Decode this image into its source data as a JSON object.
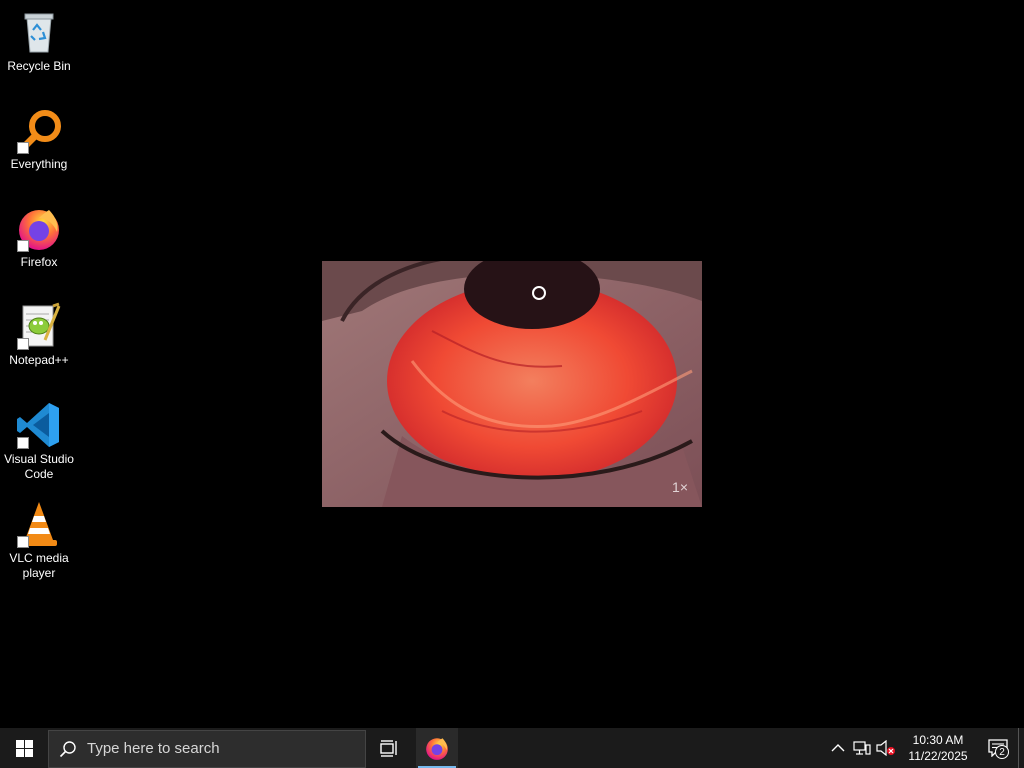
{
  "desktop": {
    "icons": [
      {
        "label": "Recycle Bin",
        "icon": "recycle-bin-icon"
      },
      {
        "label": "Everything",
        "icon": "everything-search-icon"
      },
      {
        "label": "Firefox",
        "icon": "firefox-icon"
      },
      {
        "label": "Notepad++",
        "icon": "notepad-plus-plus-icon"
      },
      {
        "label": "Visual Studio Code",
        "icon": "vscode-icon"
      },
      {
        "label": "VLC media player",
        "icon": "vlc-icon"
      }
    ]
  },
  "video": {
    "speed_label": "1×"
  },
  "taskbar": {
    "search_placeholder": "Type here to search",
    "pinned": [
      {
        "name": "Firefox",
        "active": true
      }
    ],
    "clock": {
      "time": "10:30 AM",
      "date": "11/22/2025"
    },
    "notification_count": "2"
  },
  "colors": {
    "taskbar_bg": "#1b1b1b",
    "accent": "#76b9ed",
    "desktop_bg": "#000000"
  }
}
